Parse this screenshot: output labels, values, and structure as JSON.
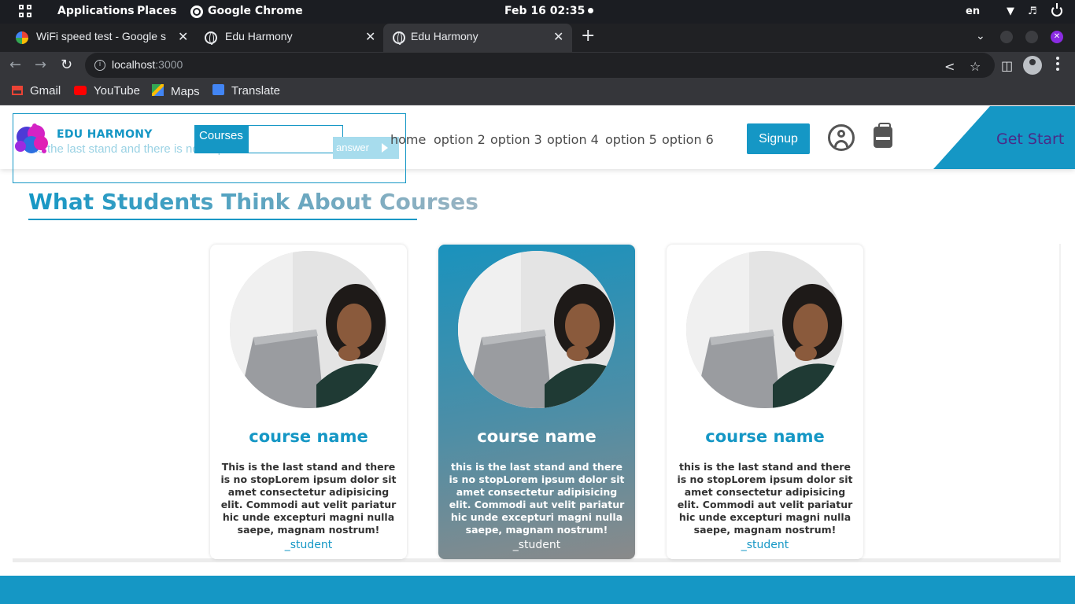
{
  "os": {
    "applications": "Applications",
    "places": "Places",
    "active_app": "Google Chrome",
    "datetime": "Feb 16  02:35",
    "lang": "en"
  },
  "browser": {
    "tabs": [
      {
        "label": "WiFi speed test - Google s",
        "icon": "google-icon"
      },
      {
        "label": "Edu Harmony",
        "icon": "globe-icon"
      },
      {
        "label": "Edu Harmony",
        "icon": "globe-icon",
        "active": true
      }
    ],
    "url_host": "localhost",
    "url_port": ":3000",
    "bookmarks": [
      {
        "label": "Gmail",
        "icon": "gmail-icon"
      },
      {
        "label": "YouTube",
        "icon": "youtube-icon"
      },
      {
        "label": "Maps",
        "icon": "maps-icon"
      },
      {
        "label": "Translate",
        "icon": "translate-icon"
      }
    ]
  },
  "site": {
    "brand": "EDU HARMONY",
    "ghost_text": "is the last stand and there is no stop",
    "courses_label": "Courses",
    "answer_label": "answer",
    "nav": [
      "home",
      "option 2",
      "option 3",
      "option 4",
      "option 5",
      "option 6"
    ],
    "signup_label": "Signup",
    "get_start_label": "Get Start",
    "section_title": "What Students Think About Courses",
    "cards": [
      {
        "name": "course name",
        "desc": "This is the last stand and there is no stopLorem ipsum dolor sit amet consectetur adipisicing elit. Commodi aut velit pariatur hic unde excepturi magni nulla saepe, magnam nostrum!",
        "author": "_student"
      },
      {
        "name": "course name",
        "desc": "this is the last stand and there is no stopLorem ipsum dolor sit amet consectetur adipisicing elit. Commodi aut velit pariatur hic unde excepturi magni nulla saepe, magnam nostrum!",
        "author": "_student"
      },
      {
        "name": "course name",
        "desc": "this is the last stand and there is no stopLorem ipsum dolor sit amet consectetur adipisicing elit. Commodi aut velit pariatur hic unde excepturi magni nulla saepe, magnam nostrum!",
        "author": "_student"
      }
    ],
    "colors": {
      "accent": "#1597c5",
      "get_start_text": "#4b2a88"
    }
  }
}
